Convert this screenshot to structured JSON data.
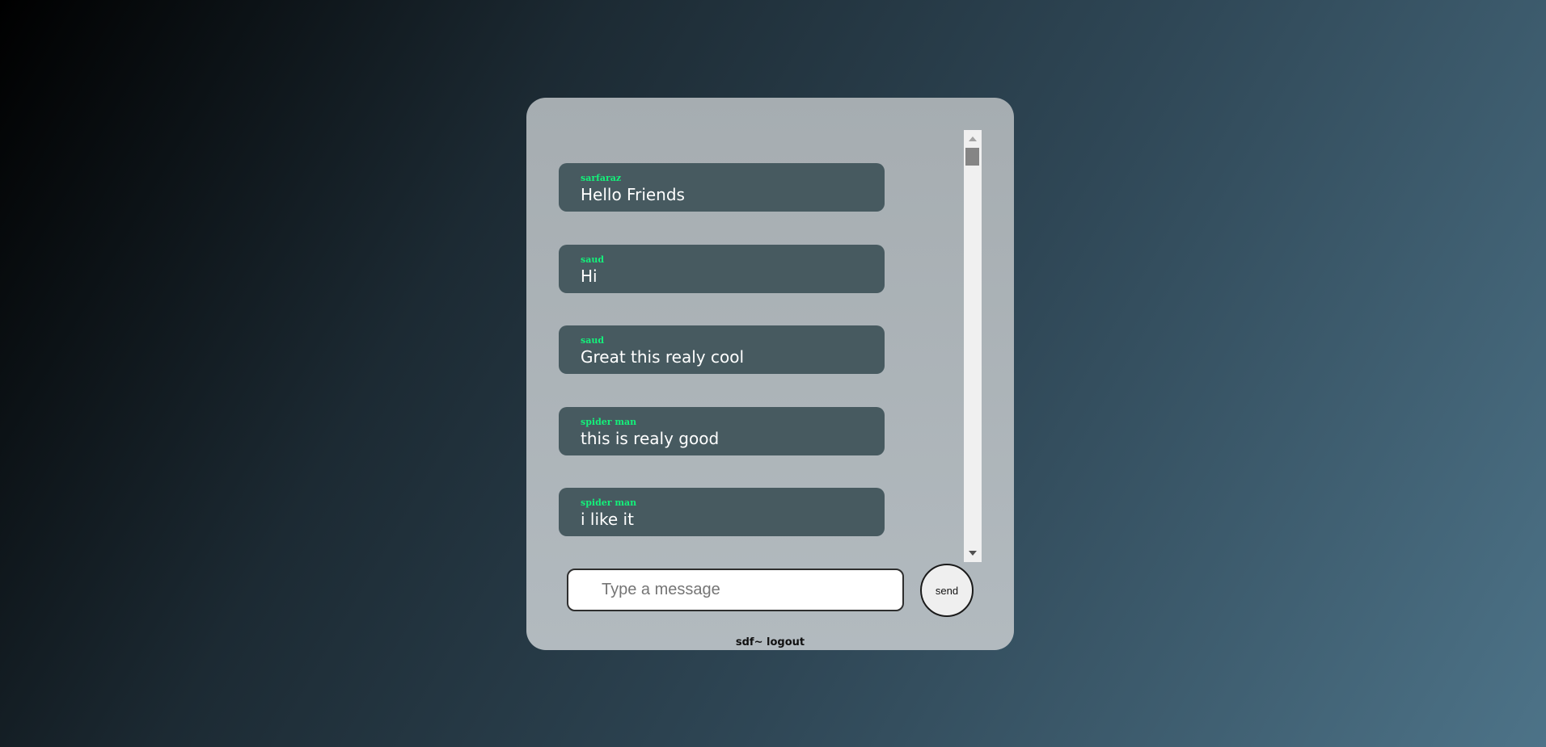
{
  "messages": [
    {
      "sender": "sarfaraz",
      "text": "Hello Friends"
    },
    {
      "sender": "saud",
      "text": "Hi"
    },
    {
      "sender": "saud",
      "text": "Great this realy cool"
    },
    {
      "sender": "spider man",
      "text": "this is realy good"
    },
    {
      "sender": "spider man",
      "text": "i like it"
    }
  ],
  "composer": {
    "placeholder": "Type a message",
    "value": "",
    "send_label": "send"
  },
  "footer": {
    "user": "sdf~",
    "logout_label": "logout"
  },
  "colors": {
    "sender_name": "#14f07a",
    "bubble_bg": "#475a60",
    "card_bg": "#a6adb1"
  }
}
